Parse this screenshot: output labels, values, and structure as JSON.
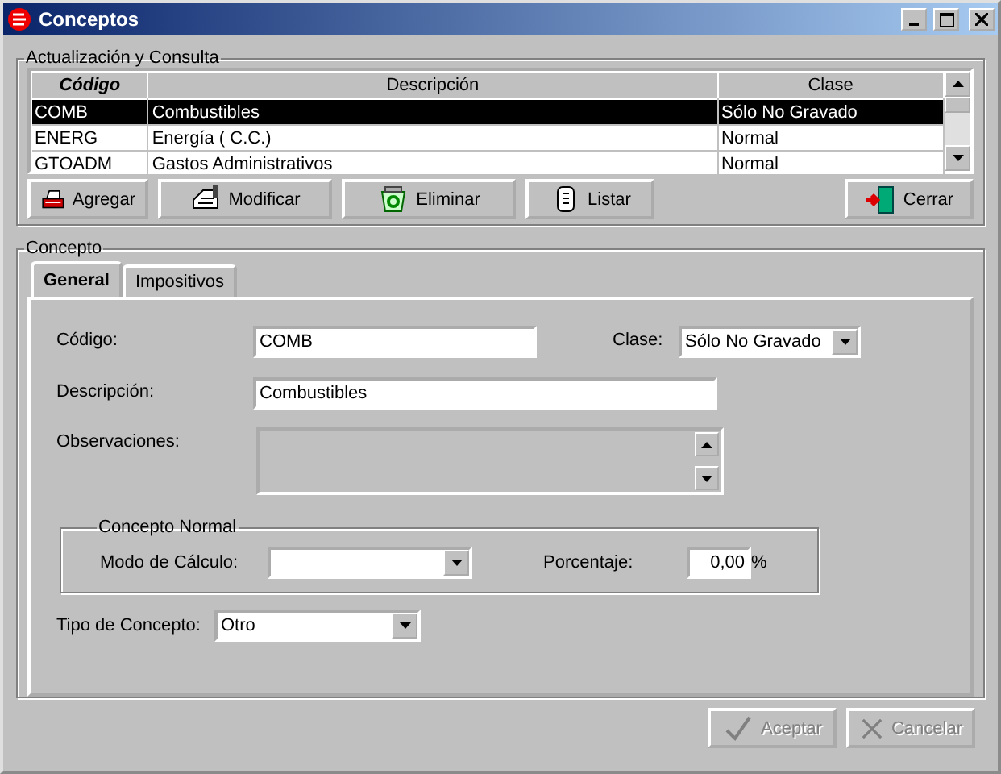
{
  "window": {
    "title": "Conceptos"
  },
  "browse": {
    "legend": "Actualización y Consulta",
    "columns": [
      {
        "label": "Código",
        "sorted": true
      },
      {
        "label": "Descripción",
        "sorted": false
      },
      {
        "label": "Clase",
        "sorted": false
      }
    ],
    "rows": [
      {
        "cells": [
          "COMB",
          "Combustibles",
          "Sólo No Gravado"
        ],
        "selected": true
      },
      {
        "cells": [
          "ENERG",
          "Energía ( C.C.)",
          "Normal"
        ],
        "selected": false
      },
      {
        "cells": [
          "GTOADM",
          "Gastos Administrativos",
          "Normal"
        ],
        "selected": false
      }
    ],
    "buttons": [
      {
        "label": "Agregar",
        "kind": "add"
      },
      {
        "label": "Modificar",
        "kind": "edit"
      },
      {
        "label": "Eliminar",
        "kind": "delete"
      },
      {
        "label": "Listar",
        "kind": "list"
      }
    ],
    "close_button": {
      "label": "Cerrar",
      "kind": "exit"
    }
  },
  "concepto": {
    "legend": "Concepto",
    "tabs": [
      {
        "label": "General",
        "selected": true
      },
      {
        "label": "Impositivos",
        "selected": false
      }
    ],
    "codigo": {
      "label": "Código:",
      "value": "COMB"
    },
    "clase": {
      "label": "Clase:",
      "value": "Sólo No Gravado"
    },
    "descripcion": {
      "label": "Descripción:",
      "value": "Combustibles"
    },
    "observaciones": {
      "label": "Observaciones:",
      "disabled": true
    },
    "normal": {
      "legend": "Concepto Normal",
      "modo": {
        "label": "Modo de Cálculo:"
      },
      "porcentaje": {
        "label": "Porcentaje:",
        "value": "0,00",
        "unit": "%"
      }
    },
    "tipo": {
      "label": "Tipo de Concepto:",
      "value": "Otro"
    }
  },
  "footer_buttons": [
    {
      "label": "Aceptar",
      "kind": "accept",
      "disabled": true
    },
    {
      "label": "Cancelar",
      "kind": "cancel",
      "disabled": true
    }
  ]
}
